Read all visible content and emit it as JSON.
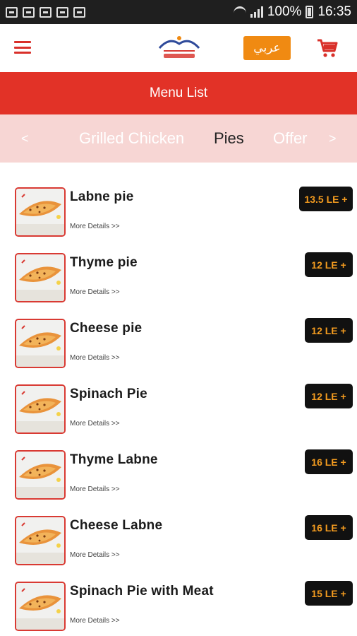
{
  "status_bar": {
    "battery_text": "100%",
    "time": "16:35",
    "icons": [
      "notification-icon",
      "calendar-icon",
      "image-icon",
      "mail-icon",
      "screenshot-icon"
    ]
  },
  "header": {
    "menu_icon": "hamburger-menu-icon",
    "logo": "brand-logo",
    "language_button": "عربي",
    "cart_icon": "shopping-cart-icon"
  },
  "title": "Menu List",
  "tabs": {
    "prev_arrow": "<",
    "next_arrow": ">",
    "items": [
      {
        "label": "Grilled Chicken",
        "active": false
      },
      {
        "label": "Pies",
        "active": true
      },
      {
        "label": "Offer",
        "active": false
      }
    ]
  },
  "menu_items": [
    {
      "name": "Labne pie",
      "more": "More Details >>",
      "price": "13.5 LE +"
    },
    {
      "name": "Thyme pie",
      "more": "More Details >>",
      "price": "12 LE +"
    },
    {
      "name": "Cheese pie",
      "more": "More Details >>",
      "price": "12 LE +"
    },
    {
      "name": "Spinach Pie",
      "more": "More Details >>",
      "price": "12 LE +"
    },
    {
      "name": "Thyme Labne",
      "more": "More Details >>",
      "price": "16 LE +"
    },
    {
      "name": "Cheese Labne",
      "more": "More Details >>",
      "price": "16 LE +"
    },
    {
      "name": "Spinach Pie with Meat",
      "more": "More Details >>",
      "price": "15 LE +"
    }
  ],
  "colors": {
    "brand_red": "#e23227",
    "accent_orange": "#f08a12",
    "price_text": "#f39b1f",
    "tab_bg": "#f7d6d4"
  }
}
